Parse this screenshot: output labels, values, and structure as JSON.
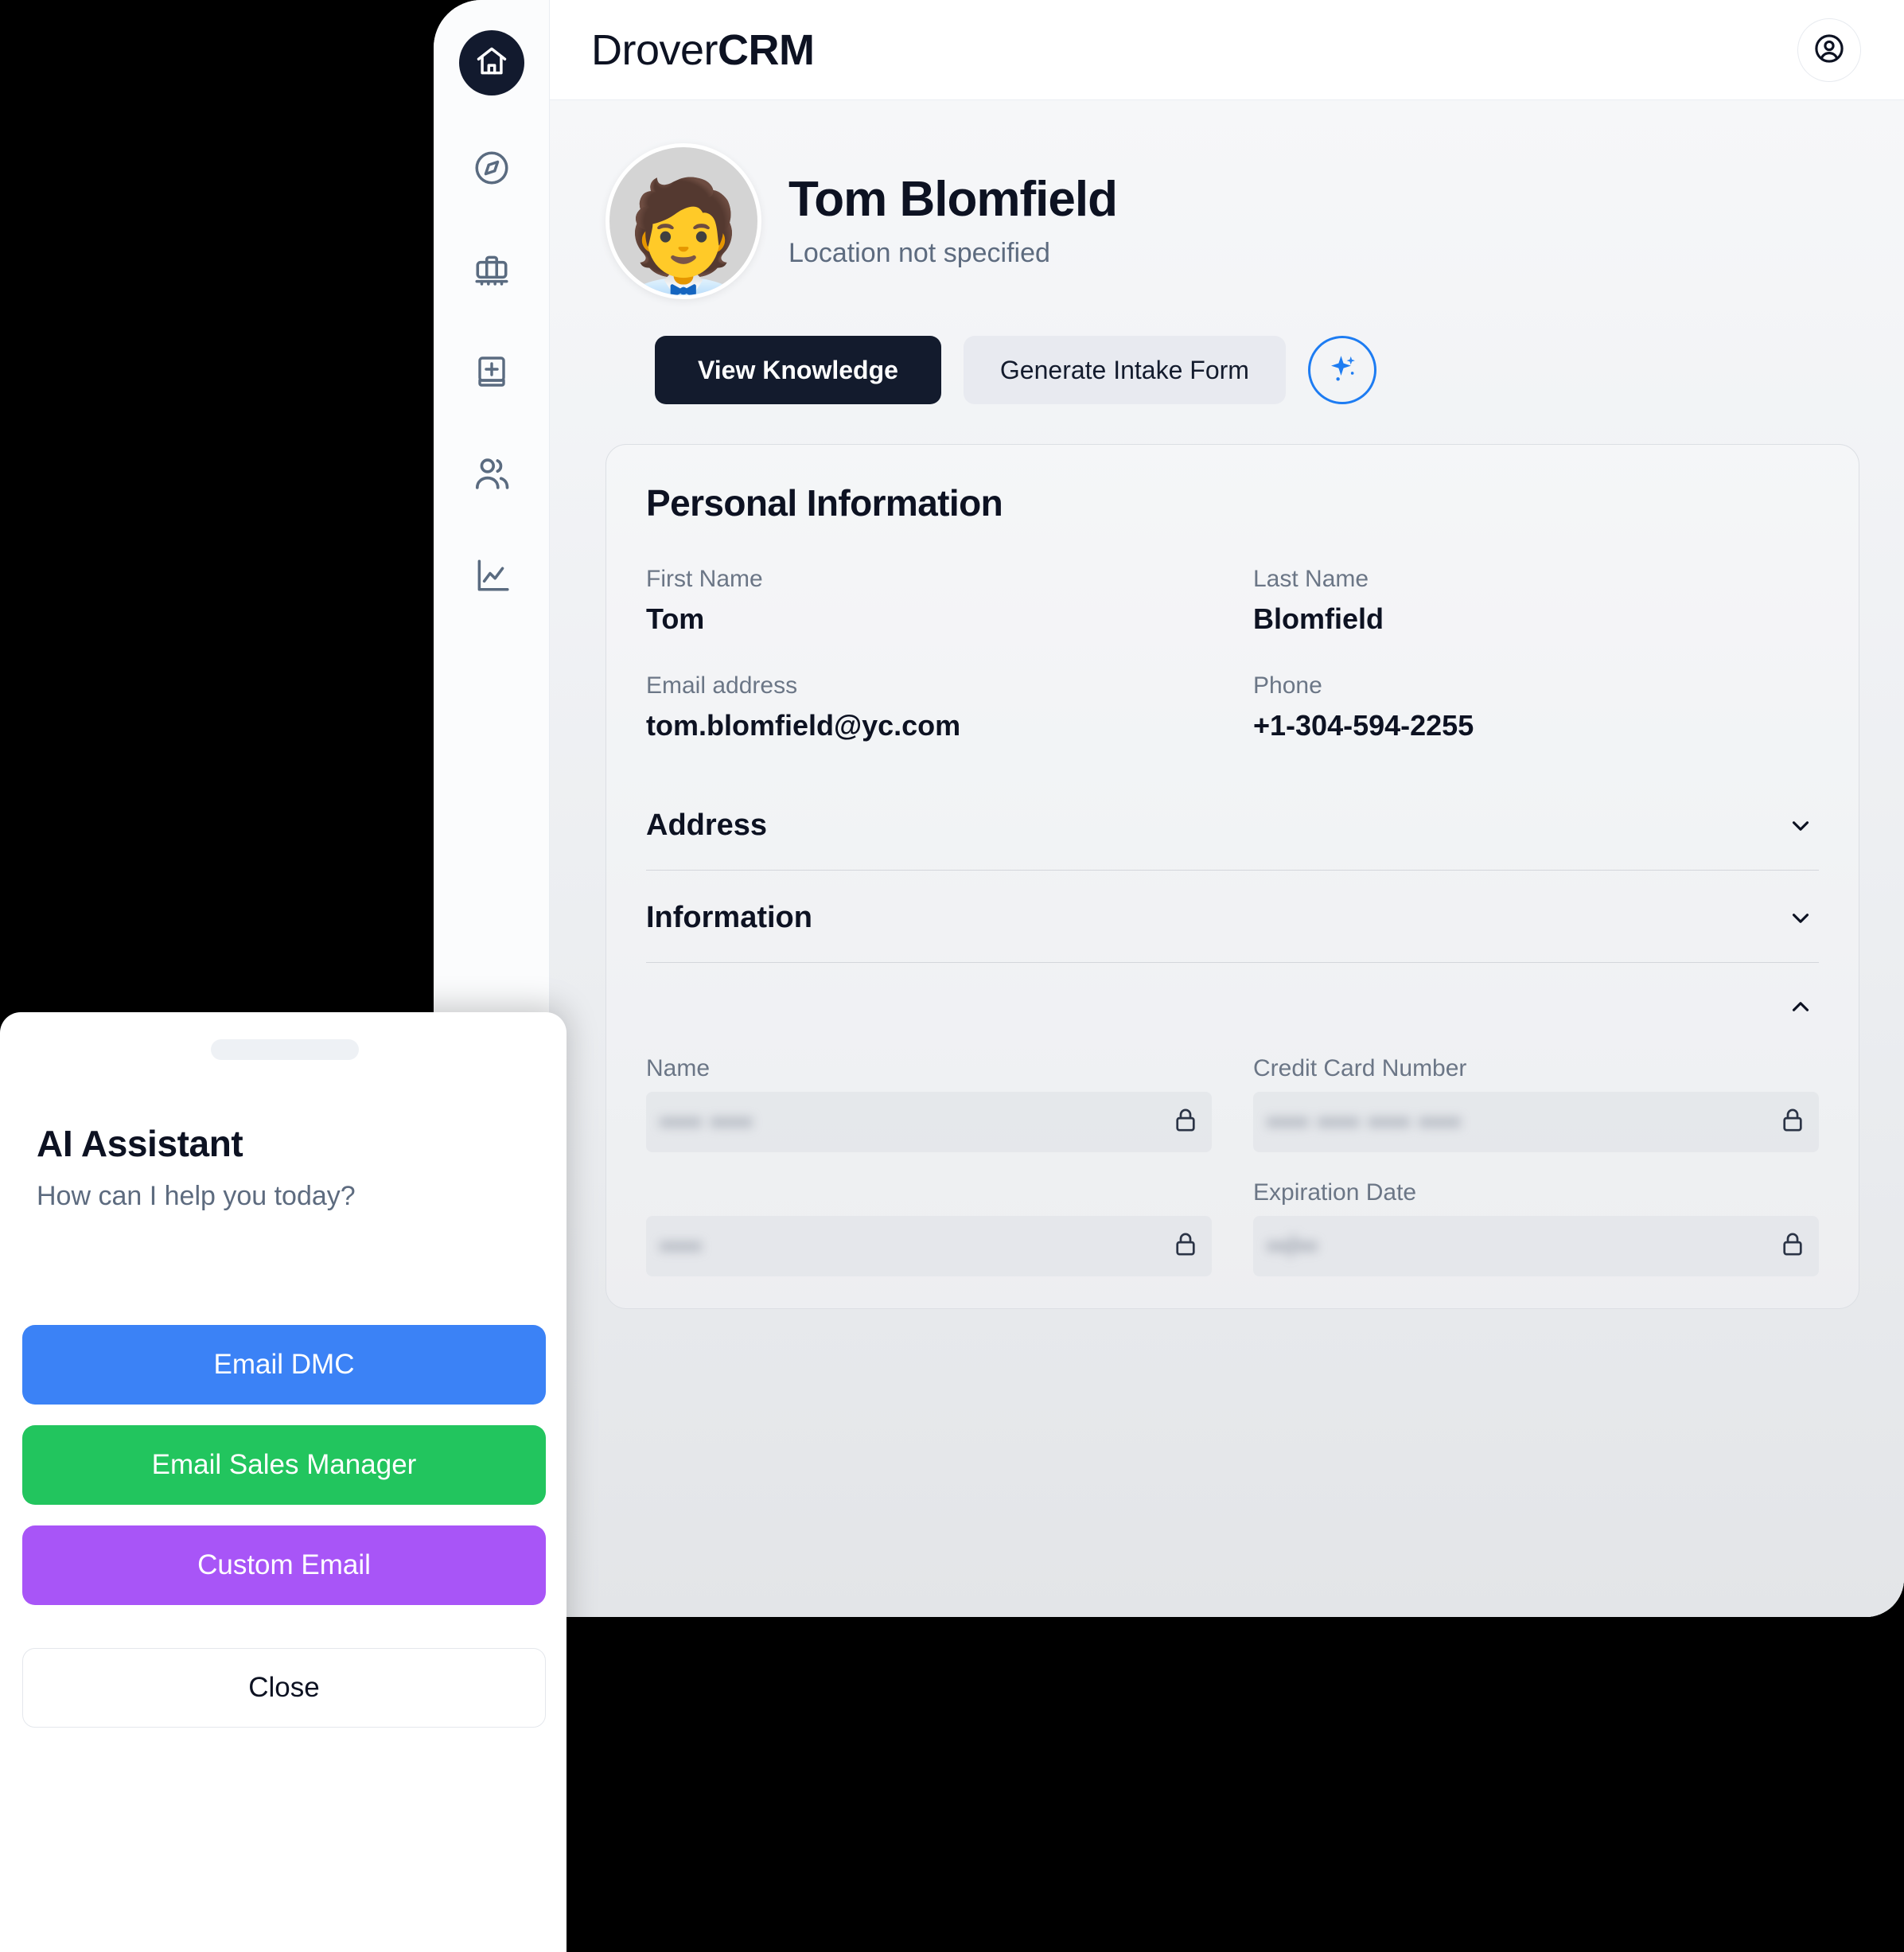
{
  "app": {
    "brand_prefix": "Drover",
    "brand_suffix": "CRM",
    "account_icon": "user-circle-icon"
  },
  "sidebar": {
    "items": [
      {
        "icon": "home-icon",
        "name": "home",
        "active": true
      },
      {
        "icon": "compass-icon",
        "name": "explore",
        "active": false
      },
      {
        "icon": "briefcase-icon",
        "name": "trips",
        "active": false
      },
      {
        "icon": "book-plus-icon",
        "name": "knowledge",
        "active": false
      },
      {
        "icon": "users-icon",
        "name": "contacts",
        "active": false
      },
      {
        "icon": "chart-line-icon",
        "name": "analytics",
        "active": false
      }
    ]
  },
  "profile": {
    "avatar_emoji": "🧑‍💼",
    "name": "Tom Blomfield",
    "location": "Location not specified",
    "actions": {
      "view_knowledge": "View Knowledge",
      "generate_intake_form": "Generate Intake Form",
      "ai_sparkle": "sparkle-icon"
    }
  },
  "personal_information": {
    "title": "Personal Information",
    "fields": [
      {
        "label": "First Name",
        "value": "Tom"
      },
      {
        "label": "Last Name",
        "value": "Blomfield"
      },
      {
        "label": "Email address",
        "value": "tom.blomfield@yc.com"
      },
      {
        "label": "Phone",
        "value": "+1-304-594-2255"
      }
    ]
  },
  "accordions": [
    {
      "title": "Address",
      "state": "collapsed",
      "chevron": "chevron-down-icon"
    },
    {
      "title": "Information",
      "state": "collapsed",
      "chevron": "chevron-down-icon"
    },
    {
      "title": "",
      "state": "expanded",
      "chevron": "chevron-up-icon"
    }
  ],
  "payment": {
    "fields": [
      {
        "label": "Name",
        "masked_value": "•••• ••••",
        "lock": "lock-icon"
      },
      {
        "label": "Credit Card Number",
        "masked_value": "•••• •••• •••• ••••",
        "lock": "lock-icon"
      },
      {
        "label": "",
        "masked_value": "••••",
        "lock": "lock-icon"
      },
      {
        "label": "Expiration Date",
        "masked_value": "••/••",
        "lock": "lock-icon"
      }
    ]
  },
  "assistant_sheet": {
    "title": "AI Assistant",
    "subtitle": "How can I help you today?",
    "buttons": [
      {
        "label": "Email DMC",
        "color": "#3b82f6"
      },
      {
        "label": "Email Sales Manager",
        "color": "#22c55e"
      },
      {
        "label": "Custom Email",
        "color": "#a855f7"
      }
    ],
    "close_label": "Close"
  },
  "colors": {
    "brand_dark": "#131b2d",
    "accent_blue": "#1d7cf2",
    "sheet_blue": "#3b82f6",
    "sheet_green": "#22c55e",
    "sheet_purple": "#a855f7"
  }
}
